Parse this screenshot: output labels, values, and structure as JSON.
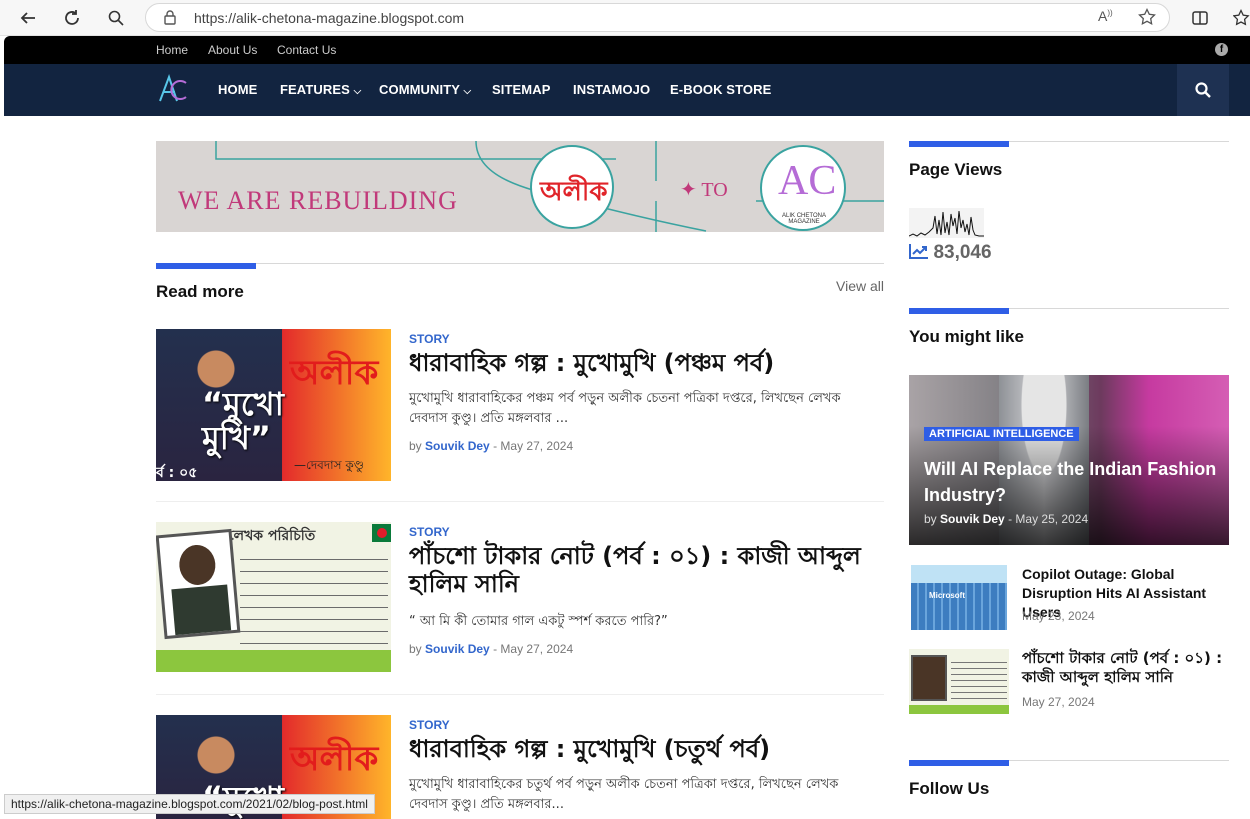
{
  "browser": {
    "url": "https://alik-chetona-magazine.blogspot.com",
    "status_url": "https://alik-chetona-magazine.blogspot.com/2021/02/blog-post.html"
  },
  "topbar": {
    "links": [
      "Home",
      "About Us",
      "Contact Us"
    ]
  },
  "nav": {
    "items": [
      "HOME",
      "FEATURES",
      "COMMUNITY",
      "SITEMAP",
      "INSTAMOJO",
      "E-BOOK STORE"
    ]
  },
  "banner": {
    "text": "WE ARE REBUILDING",
    "left_logo": "অলীক",
    "to": "✦ TO",
    "right_logo": "AC",
    "right_logo_sub": "ALIK CHETONA MAGAZINE"
  },
  "read_more": {
    "title": "Read more",
    "view_all": "View all"
  },
  "posts": [
    {
      "category": "STORY",
      "title": "ধারাবাহিক গল্প : মুখোমুখি (পঞ্চম পর্ব)",
      "excerpt": "মুখোমুখি ধারাবাহিকের পঞ্চম পর্ব পড়ুন অলীক চেতনা পত্রিকা দপ্তরে, লিখছেন লেখক দেবদাস কুণ্ডু। প্রতি মঙ্গলবার ...",
      "by": "by",
      "author": "Souvik Dey",
      "date": "May 27, 2024",
      "thumb": {
        "logo": "অলীক",
        "big": "“মুখো মুখি”",
        "sub": "—দেবদাস কুণ্ডু",
        "ep": "র্ব : ০৫"
      }
    },
    {
      "category": "STORY",
      "title": "পাঁচশো টাকার নোট (পর্ব : ০১) : কাজী আব্দুল হালিম সানি",
      "excerpt": "“ আ মি কী তোমার গাল একটু স্পর্শ করতে পারি?”",
      "by": "by",
      "author": "Souvik Dey",
      "date": "May 27, 2024",
      "thumb": {
        "heading": "লেখক পরিচিতি"
      }
    },
    {
      "category": "STORY",
      "title": "ধারাবাহিক গল্প : মুখোমুখি (চতুর্থ পর্ব)",
      "excerpt": "মুখোমুখি ধারাবাহিকের চতুর্থ পর্ব পড়ুন অলীক চেতনা পত্রিকা দপ্তরে, লিখছেন লেখক দেবদাস কুণ্ডু। প্রতি মঙ্গলবার...",
      "thumb": {
        "logo": "অলীক",
        "big": "“মুখো"
      }
    }
  ],
  "sidebar": {
    "page_views": {
      "title": "Page Views",
      "count": "83,046"
    },
    "you_might_like": {
      "title": "You might like",
      "featured": {
        "category": "ARTIFICIAL INTELLIGENCE",
        "title": "Will AI Replace the Indian Fashion Industry?",
        "by": "by",
        "author": "Souvik Dey",
        "date": "May 25, 2024"
      },
      "items": [
        {
          "title": "Copilot Outage: Global Disruption Hits AI Assistant Users",
          "date": "May 23, 2024",
          "thumb_label": "Microsoft"
        },
        {
          "title": "পাঁচশো টাকার নোট (পর্ব : ০১) : কাজী আব্দুল হালিম সানি",
          "date": "May 27, 2024"
        }
      ]
    },
    "follow": {
      "title": "Follow Us"
    }
  },
  "colors": {
    "accent": "#2f5ee6",
    "nav_bg": "#122440",
    "link": "#3266cc"
  }
}
